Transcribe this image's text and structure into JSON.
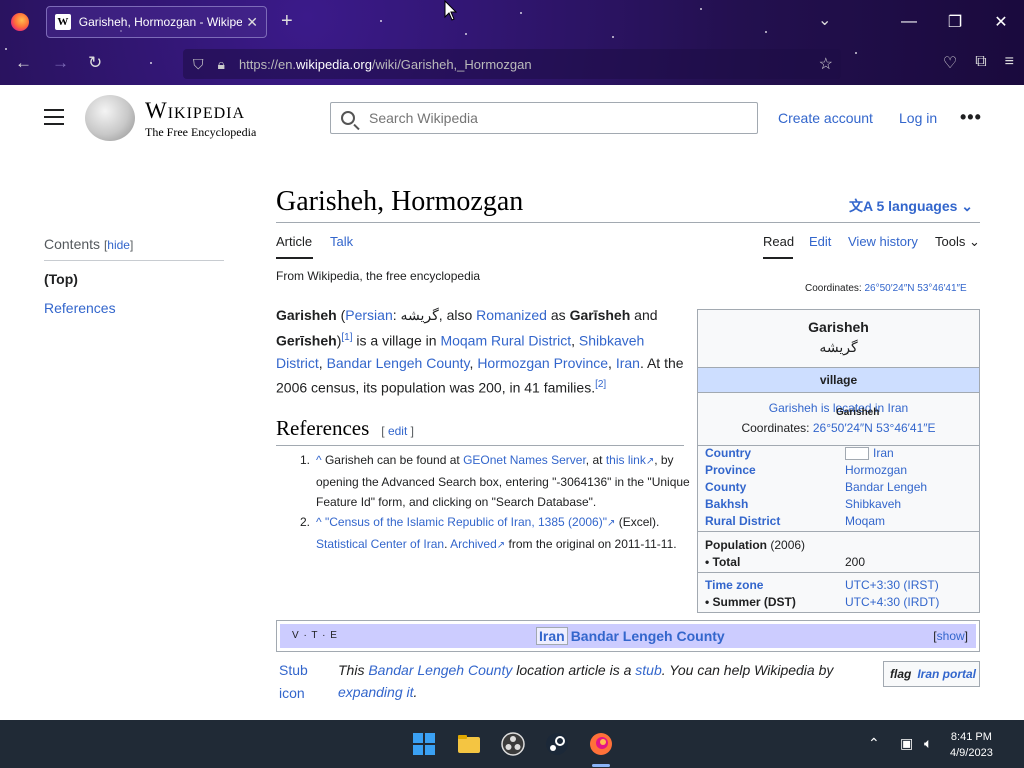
{
  "browser": {
    "tab_title": "Garisheh, Hormozgan - Wikipedia",
    "tab_favicon": "W",
    "url_prefix": "https://en.",
    "url_domain": "wikipedia.org",
    "url_path": "/wiki/Garisheh,_Hormozgan"
  },
  "header": {
    "wordmark": "Wikipedia",
    "tagline": "The Free Encyclopedia",
    "search_placeholder": "Search Wikipedia",
    "create_account": "Create account",
    "log_in": "Log in"
  },
  "toc": {
    "heading": "Contents",
    "hide": "hide",
    "items": [
      "(Top)",
      "References"
    ]
  },
  "article": {
    "title": "Garisheh, Hormozgan",
    "languages": "5 languages",
    "tabs": {
      "article": "Article",
      "talk": "Talk",
      "read": "Read",
      "edit": "Edit",
      "history": "View history",
      "tools": "Tools"
    },
    "from_wp": "From Wikipedia, the free encyclopedia",
    "coords_label": "Coordinates:",
    "coords_value": "26°50′24″N 53°46′41″E",
    "lead": {
      "name": "Garisheh",
      "persian_link": "Persian",
      "persian_name": "گریشه",
      "also": ", also ",
      "romanized": "Romanized",
      "as": " as ",
      "alt1": "Garīsheh",
      "and": " and ",
      "alt2": "Gerīsheh",
      "ref1": "[1]",
      "is_village": " is a village in ",
      "loc1": "Moqam Rural District",
      "loc2": "Shibkaveh District",
      "loc3": "Bandar Lengeh County",
      "loc4": "Hormozgan Province",
      "loc5": "Iran",
      "census": ". At the 2006 census, its population was 200, in 41 families.",
      "ref2": "[2]"
    },
    "references": {
      "heading": "References",
      "edit": "edit",
      "r1": {
        "caret": "^",
        "pre": " Garisheh can be found at ",
        "link1": "GEOnet Names Server",
        "mid": ", at ",
        "link2": "this link",
        "post": ", by opening the Advanced Search box, entering \"-3064136\" in the \"Unique Feature Id\" form, and clicking on \"Search Database\"."
      },
      "r2": {
        "caret": "^",
        "link1": "\"Census of the Islamic Republic of Iran, 1385 (2006)\"",
        "mid": " (Excel). ",
        "link2": "Statistical Center of Iran",
        "dot": ". ",
        "link3": "Archived",
        "post": " from the original on 2011-11-11."
      }
    }
  },
  "infobox": {
    "title": "Garisheh",
    "native": "گریشه",
    "type": "village",
    "map_link": "Garisheh is located in Iran",
    "map_overlay": "Garisheh",
    "coords_label": "Coordinates:",
    "coords_value": "26°50′24″N 53°46′41″E",
    "rows": [
      {
        "k": "Country",
        "v": "Iran"
      },
      {
        "k": "Province",
        "v": "Hormozgan"
      },
      {
        "k": "County",
        "v": "Bandar Lengeh"
      },
      {
        "k": "Bakhsh",
        "v": "Shibkaveh"
      },
      {
        "k": "Rural District",
        "v": "Moqam"
      }
    ],
    "population_label": "Population",
    "population_year": "(2006)",
    "total_label": " • Total",
    "total_value": "200",
    "timezone_label": "Time zone",
    "timezone_value": "UTC+3:30 (IRST)",
    "summer_label": " • Summer (DST)",
    "summer_value": "UTC+4:30 (IRDT)"
  },
  "navbox": {
    "vte": "V · T · E",
    "iran": "Iran",
    "title": "Bandar Lengeh County",
    "show": "show"
  },
  "stub": {
    "icon_text": "Stub icon",
    "pre": "This ",
    "link1": "Bandar Lengeh County",
    "mid": " location article is a ",
    "link2": "stub",
    "mid2": ". You can help Wikipedia by ",
    "link3": "expanding it",
    "end": ".",
    "portal_flag": "flag",
    "portal_label": "Iran portal"
  },
  "taskbar": {
    "time": "8:41 PM",
    "date": "4/9/2023"
  }
}
